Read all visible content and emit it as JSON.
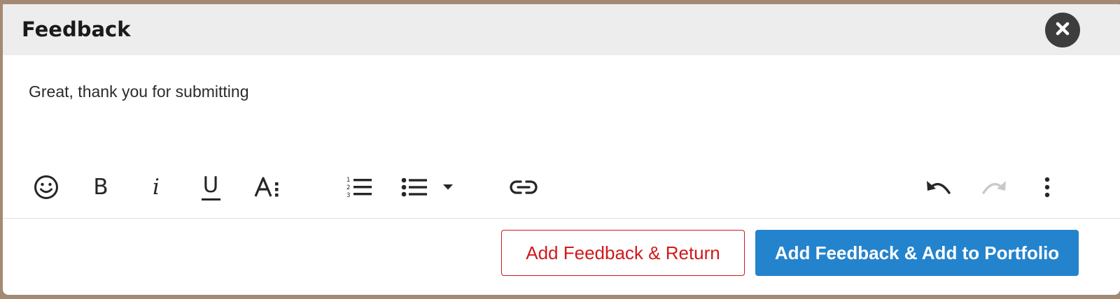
{
  "dialog": {
    "title": "Feedback",
    "close_icon": "close-x-icon",
    "body_text": "Great, thank you for submitting"
  },
  "toolbar": {
    "emoji_icon": "emoji-smile-icon",
    "bold_label": "B",
    "italic_label": "i",
    "underline_label": "U",
    "font_size_icon": "font-size-icon",
    "ordered_list_icon": "ordered-list-icon",
    "unordered_list_icon": "unordered-list-icon",
    "list_dropdown_icon": "caret-down-icon",
    "link_icon": "link-icon",
    "undo_icon": "undo-icon",
    "redo_icon": "redo-icon",
    "more_icon": "more-vertical-icon"
  },
  "actions": {
    "return_label": "Add Feedback & Return",
    "portfolio_label": "Add Feedback & Add to Portfolio"
  },
  "colors": {
    "header_bg": "#ededed",
    "primary": "#2483cd",
    "danger": "#d0191c",
    "close_bg": "#3d3d3d"
  }
}
